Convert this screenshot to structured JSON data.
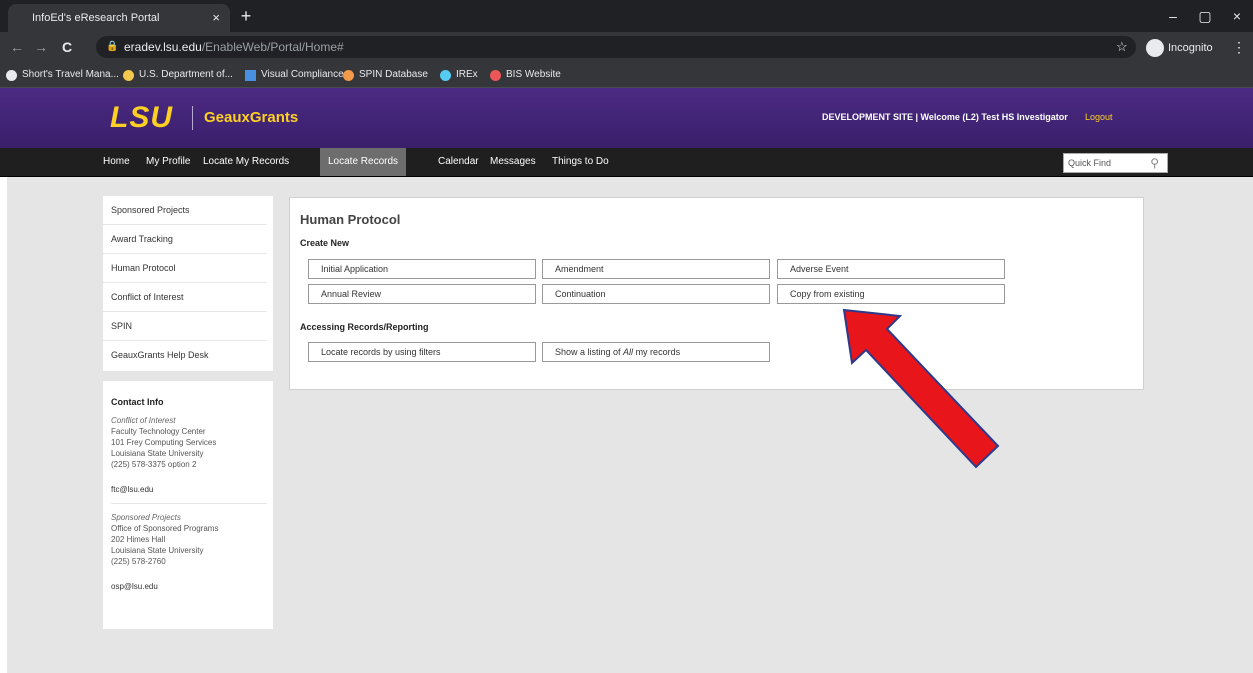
{
  "browser": {
    "tab_title": "InfoEd's eResearch Portal",
    "tab_close": "×",
    "new_tab": "+",
    "minimize": "–",
    "maximize": "▢",
    "close": "×",
    "back": "←",
    "forward": "→",
    "reload": "C",
    "url_host": "eradev.lsu.edu",
    "url_path": "/EnableWeb/Portal/Home#",
    "incognito_label": "Incognito",
    "bookmarks": [
      {
        "label": "Short's Travel Mana...",
        "color": "#e8eaed"
      },
      {
        "label": "U.S. Department of...",
        "color": "#f2c94c"
      },
      {
        "label": "Visual Compliance",
        "color": "#4a90e2"
      },
      {
        "label": "SPIN Database",
        "color": "#f2994a"
      },
      {
        "label": "IREx",
        "color": "#56ccf2"
      },
      {
        "label": "BIS Website",
        "color": "#eb5757"
      }
    ]
  },
  "header": {
    "logo": "LSU",
    "app_name": "GeauxGrants",
    "welcome": "DEVELOPMENT SITE | Welcome (L2) Test HS Investigator",
    "logout": "Logout"
  },
  "nav": {
    "items": [
      "Home",
      "My Profile",
      "Locate My Records",
      "Locate Records",
      "Calendar",
      "Messages",
      "Things to Do"
    ],
    "active_index": 3,
    "quick_find": "Quick Find"
  },
  "sidebar": {
    "items": [
      "Sponsored Projects",
      "Award Tracking",
      "Human Protocol",
      "Conflict of Interest",
      "SPIN",
      "GeauxGrants Help Desk"
    ]
  },
  "contact": {
    "title": "Contact Info",
    "coi_label": "Conflict of Interest",
    "coi_lines": [
      "Faculty Technology Center",
      "101 Frey Computing Services",
      "Louisiana State University",
      "(225) 578-3375 option 2"
    ],
    "coi_email": "ftc@lsu.edu",
    "sp_label": "Sponsored Projects",
    "sp_lines": [
      "Office of Sponsored Programs",
      "202 Himes Hall",
      "Louisiana State University",
      "(225) 578-2760"
    ],
    "sp_email": "osp@lsu.edu"
  },
  "panel": {
    "title": "Human Protocol",
    "create_new_label": "Create New",
    "create_buttons": [
      "Initial Application",
      "Amendment",
      "Adverse Event",
      "Annual Review",
      "Continuation",
      "Copy from existing"
    ],
    "access_label": "Accessing Records/Reporting",
    "locate_button": "Locate records by using filters",
    "listing_prefix": "Show a listing of ",
    "listing_em": "All",
    "listing_suffix": " my records"
  },
  "colors": {
    "lsu_purple": "#4b2a83",
    "lsu_gold": "#fdd023",
    "arrow_red": "#e8151b",
    "arrow_outline": "#2b3a8c"
  }
}
